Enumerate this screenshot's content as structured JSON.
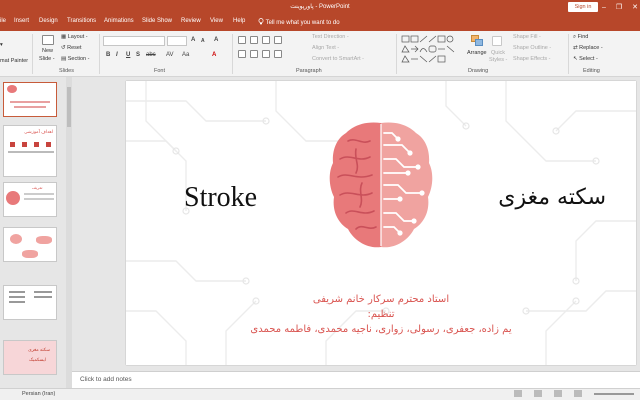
{
  "window": {
    "title": "پاورپوینت - PowerPoint",
    "sign_in": "Sign in",
    "minimize": "–",
    "restore": "❐",
    "close": "✕"
  },
  "tabs": {
    "file": "ile",
    "home": "ome",
    "insert": "Insert",
    "design": "Design",
    "transitions": "Transitions",
    "animations": "Animations",
    "slideshow": "Slide Show",
    "review": "Review",
    "view": "View",
    "help": "Help",
    "tell_me": "Tell me what you want to do"
  },
  "ribbon": {
    "clipboard": {
      "format_painter": "mat Painter"
    },
    "slides": {
      "new_slide": "New",
      "new_slide2": "Slide -",
      "layout": "Layout -",
      "reset": "Reset",
      "section": "Section -",
      "label": "Slides"
    },
    "font": {
      "label": "Font",
      "bold": "B",
      "italic": "I",
      "underline": "U",
      "strike": "S",
      "abc": "abc",
      "spacing": "AV",
      "case": "Aa",
      "grow": "A",
      "shrink": "A",
      "clear": "A",
      "color": "A"
    },
    "paragraph": {
      "label": "Paragraph",
      "text_direction": "Text Direction -",
      "align_text": "Align Text -",
      "smartart": "Convert to SmartArt -"
    },
    "drawing": {
      "label": "Drawing",
      "arrange": "Arrange",
      "quick_styles": "Quick",
      "quick_styles2": "Styles -",
      "shape_fill": "Shape Fill -",
      "shape_outline": "Shape Outline -",
      "shape_effects": "Shape Effects -"
    },
    "editing": {
      "label": "Editing",
      "find": "Find",
      "replace": "Replace -",
      "select": "Select -"
    }
  },
  "thumbnails": {
    "t2_title": "اهداف آموزشی",
    "t3_title": "تعریف",
    "t6_text1": "سکته مغزی",
    "t6_text2": "ایسکمیک"
  },
  "slide": {
    "title_en": "Stroke",
    "title_fa": "سکته مغزی",
    "instructor": "استاد محترم سرکار خانم شریفی",
    "prepared_label": "تنظیم:",
    "authors": "یم زاده، جعفری، رسولی، زواری، ناجیه محمدی، فاطمه محمدی"
  },
  "notes": {
    "placeholder": "Click to add notes"
  },
  "status": {
    "language": "Persian (Iran)"
  },
  "colors": {
    "accent": "#b7472a",
    "brain": "#e8797a",
    "brain_light": "#f0a3a0",
    "subtitle": "#d9534f"
  }
}
